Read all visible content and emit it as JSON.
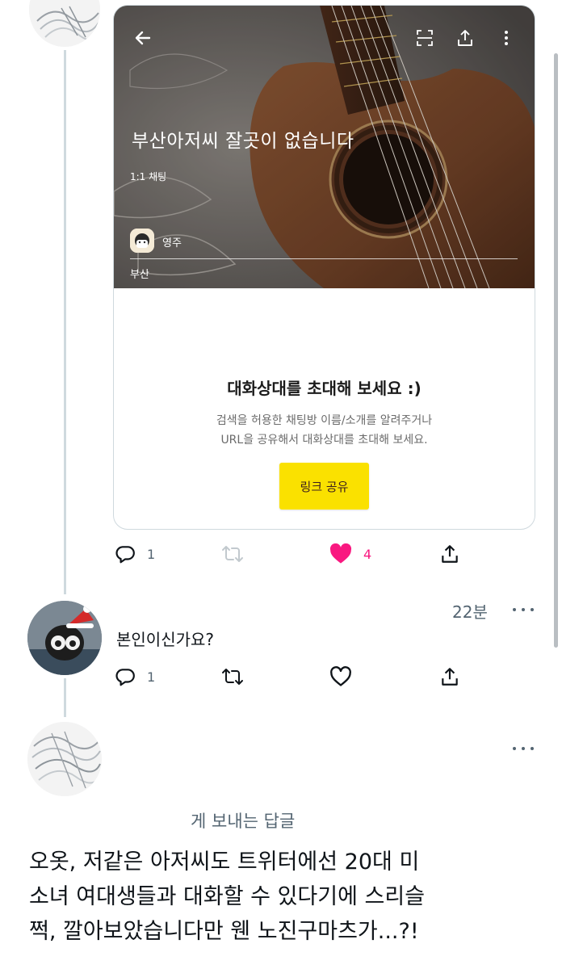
{
  "card": {
    "title": "부산아저씨 잘곳이 없습니다",
    "subtitle": "1:1 채팅",
    "owner_name": "영주",
    "tag": "부산",
    "invite_title": "대화상대를 초대해 보세요 :)",
    "invite_desc_line1": "검색을 허용한 채팅방 이름/소개를 알려주거나",
    "invite_desc_line2": "URL을 공유해서 대화상대를 초대해 보세요.",
    "share_button_label": "링크 공유",
    "icons": [
      "back-arrow-icon",
      "scan-icon",
      "share-upload-icon",
      "more-vertical-icon"
    ]
  },
  "first_tweet_actions": {
    "reply_count": "1",
    "retweet_count": "",
    "like_count": "4",
    "like_color": "#f91880"
  },
  "reply_tweet": {
    "timestamp": "22분",
    "text": "본인이신가요?",
    "reply_count": "1",
    "retweet_count": "",
    "like_count": ""
  },
  "focused_tweet": {
    "replying_to": "게 보내는 답글",
    "text_line1": "오옷, 저같은 아저씨도 트위터에선 20대 미",
    "text_line2": "소녀 여대생들과 대화할 수 있다기에 스리슬",
    "text_line3": "쩍, 깔아보았습니다만 웬 노진구마츠가...?!"
  },
  "colors": {
    "text_primary": "#0f1419",
    "text_secondary": "#536471",
    "thread_line": "#cfd9de",
    "kakao_yellow": "#fae100",
    "like_pink": "#f91880"
  }
}
